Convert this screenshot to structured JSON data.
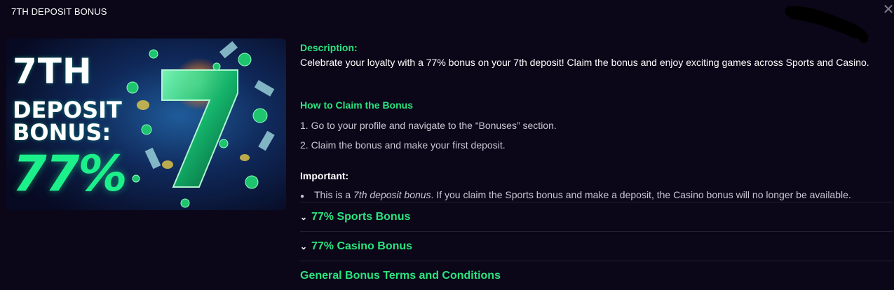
{
  "modal": {
    "title": "7TH DEPOSIT BONUS",
    "close_icon": "close-icon"
  },
  "banner": {
    "line1": "7TH",
    "line2": "DEPOSIT",
    "line3": "BONUS:",
    "line4": "77%"
  },
  "description": {
    "label": "Description:",
    "text": "Celebrate your loyalty with a 77% bonus on your 7th deposit! Claim the bonus and enjoy exciting games across Sports and Casino."
  },
  "how_to": {
    "heading": "How to Claim the Bonus",
    "steps": [
      "1. Go to your profile and navigate to the “Bonuses” section.",
      "2. Claim the bonus and make your first deposit."
    ]
  },
  "important": {
    "label": "Important:",
    "note_prefix": "This is a ",
    "note_emph": "7th deposit bonus",
    "note_suffix": ". If you claim the Sports bonus and make a deposit, the Casino bonus will no longer be available."
  },
  "accordions": [
    {
      "label": "77% Sports Bonus",
      "icon": "chevron-down-icon"
    },
    {
      "label": "77% Casino Bonus",
      "icon": "chevron-down-icon"
    }
  ],
  "general_terms": {
    "label": "General Bonus Terms and Conditions"
  },
  "colors": {
    "background": "#0b0718",
    "accent_green": "#2be37f",
    "banner_green": "#1cf08b"
  }
}
